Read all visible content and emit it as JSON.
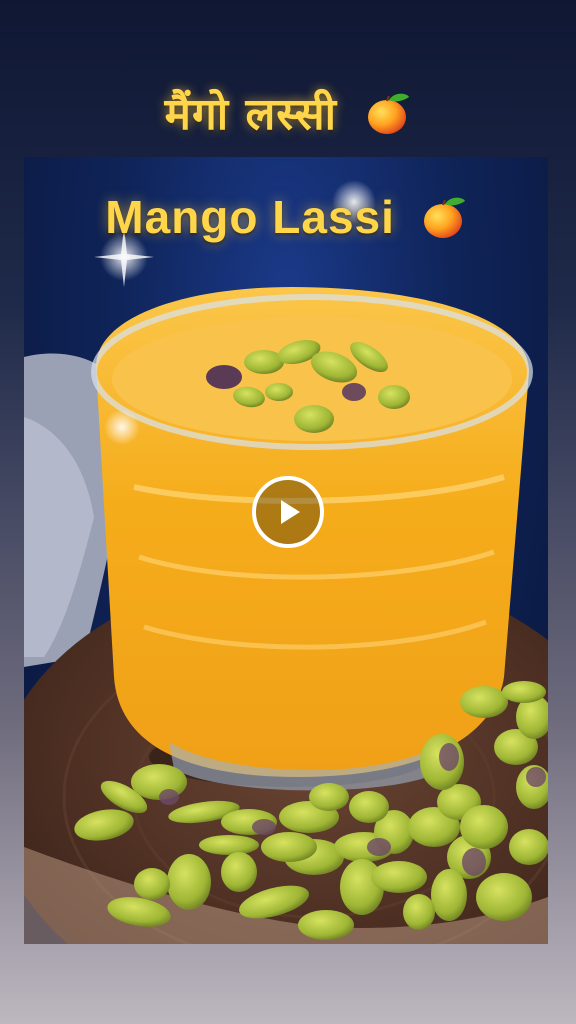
{
  "header": {
    "title_hindi": "मैंगो लस्सी"
  },
  "photo": {
    "title_english": "Mango Lassi"
  },
  "icons": {
    "title_icon": "mango-icon",
    "play": "play-icon"
  },
  "colors": {
    "title": "#ffd54a",
    "lassi": "#f6b21c",
    "pistachio": "#a9c23a"
  }
}
